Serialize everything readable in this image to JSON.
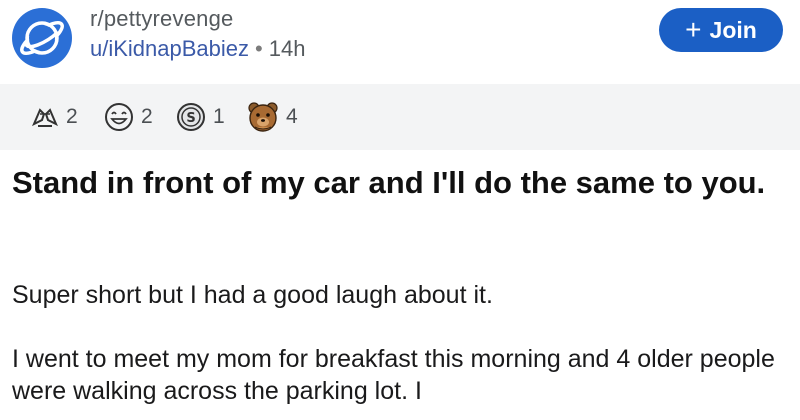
{
  "header": {
    "subreddit": "r/pettyrevenge",
    "author": "u/iKidnapBabiez",
    "separator": "•",
    "time": "14h",
    "join_label": "Join",
    "join_plus": "+",
    "subreddit_icon": "planet-icon",
    "colors": {
      "accent": "#1b5fc5",
      "author": "#3b5aa8",
      "icon_bg": "#2b6fd6"
    }
  },
  "awards": [
    {
      "icon": "hands-award-icon",
      "count": "2"
    },
    {
      "icon": "laughing-face-award-icon",
      "count": "2"
    },
    {
      "icon": "silver-coin-award-icon",
      "count": "1"
    },
    {
      "icon": "bear-face-award-icon",
      "count": "4"
    }
  ],
  "post": {
    "title": "Stand in front of my car and I'll do the same to you.",
    "paragraphs": [
      "Super short but I had a good laugh about it.",
      "I went to meet my mom for breakfast this morning and 4 older people were walking across the parking lot. I"
    ]
  }
}
